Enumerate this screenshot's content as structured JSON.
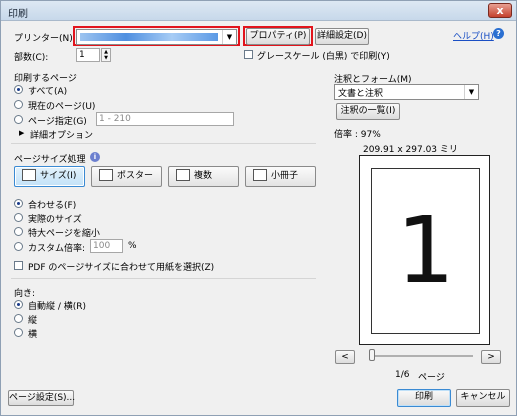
{
  "window": {
    "title": "印刷",
    "close_glyph": "x"
  },
  "printer": {
    "label": "プリンター(N):",
    "properties_button": "プロパティ(P)",
    "advanced_button": "詳細設定(D)",
    "help_link": "ヘルプ(H)",
    "copies_label": "部数(C):",
    "copies_value": "1",
    "grayscale_label": "グレースケール (白黒) で印刷(Y)"
  },
  "pages": {
    "heading": "印刷するページ",
    "all": "すべて(A)",
    "current": "現在のページ(U)",
    "range_label": "ページ指定(G)",
    "range_placeholder": "1 - 210",
    "more_options": "詳細オプション"
  },
  "sizing": {
    "heading": "ページサイズ処理",
    "buttons": {
      "size": "サイズ(I)",
      "poster": "ポスター",
      "multiple": "複数",
      "booklet": "小冊子"
    },
    "fit": "合わせる(F)",
    "actual": "実際のサイズ",
    "shrink": "特大ページを縮小",
    "custom": "カスタム倍率:",
    "custom_value": "100",
    "percent": "%",
    "pdf_paper": "PDF のページサイズに合わせて用紙を選択(Z)"
  },
  "orientation": {
    "heading": "向き:",
    "auto": "自動縦 / 横(R)",
    "portrait": "縦",
    "landscape": "横"
  },
  "comments": {
    "heading": "注釈とフォーム(M)",
    "selected": "文書と注釈",
    "summary_button": "注釈の一覧(I)"
  },
  "preview": {
    "scale": "倍率 : 97%",
    "dimensions": "209.91 x 297.03 ミリ",
    "page_number": "1",
    "page_status": "1/6",
    "page_word": "ページ",
    "prev_glyph": "<",
    "next_glyph": ">"
  },
  "footer": {
    "page_setup": "ページ設定(S)...",
    "print": "印刷",
    "cancel": "キャンセル"
  }
}
